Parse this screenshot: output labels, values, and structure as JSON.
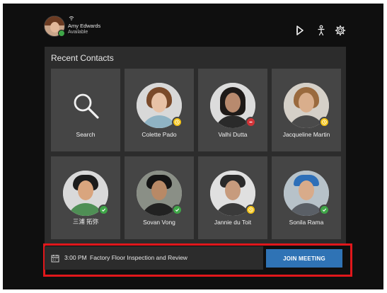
{
  "header": {
    "user_name": "Amy Edwards",
    "user_status": "Available",
    "wifi_glyph": "ⓐ"
  },
  "recent_contacts": {
    "title": "Recent Contacts",
    "search_label": "Search",
    "contacts": [
      {
        "name": "Colette Pado",
        "presence": "away"
      },
      {
        "name": "Valhi Dutta",
        "presence": "dnd"
      },
      {
        "name": "Jacqueline Martin",
        "presence": "away"
      },
      {
        "name": "三浦 拓弥",
        "presence": "available"
      },
      {
        "name": "Sovan Vong",
        "presence": "available"
      },
      {
        "name": "Jannie du Toit",
        "presence": "away"
      },
      {
        "name": "Sonila Rama",
        "presence": "available"
      }
    ]
  },
  "meeting": {
    "time": "3:00 PM",
    "title": "Factory Floor Inspection and Review",
    "join_label": "JOIN MEETING"
  },
  "colors": {
    "accent": "#2f73b5",
    "available": "#3fa648",
    "away": "#f5c518",
    "dnd": "#d13438",
    "highlight": "#e0171b"
  },
  "icons": [
    "share-screen-icon",
    "accessibility-icon",
    "settings-gear-icon",
    "search-icon",
    "calendar-icon"
  ]
}
